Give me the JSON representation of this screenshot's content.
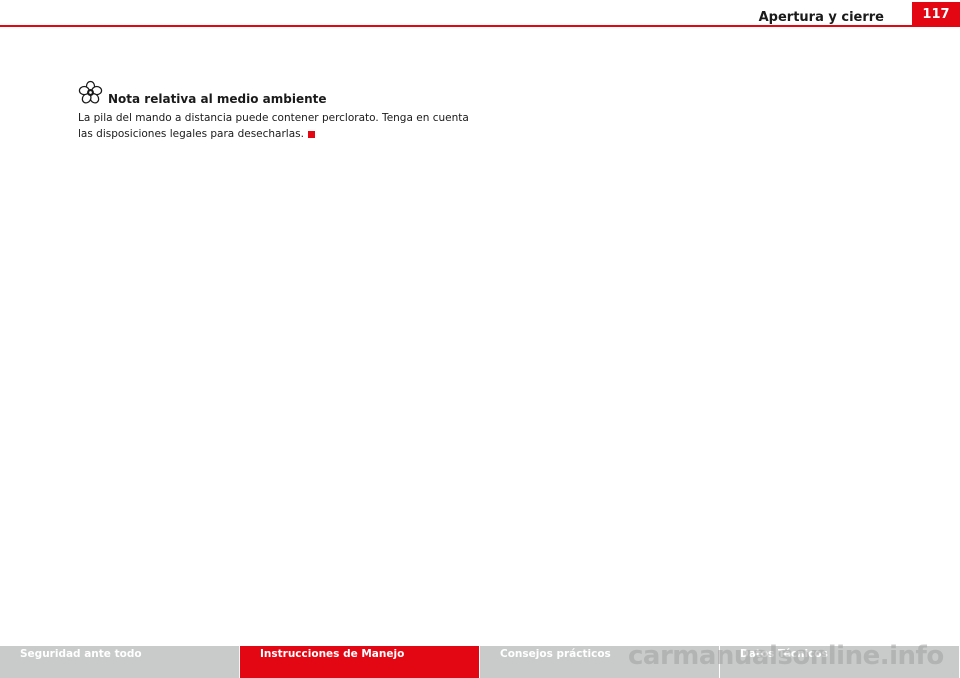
{
  "header": {
    "chapter_title": "Apertura y cierre",
    "page_number": "117",
    "accent_color": "#e30613"
  },
  "note": {
    "icon": "environment-flower-icon",
    "title": "Nota relativa al medio ambiente",
    "body": "La pila del mando a distancia puede contener perclorato. Tenga en cuenta las disposiciones legales para desecharlas."
  },
  "footer": {
    "tabs": [
      {
        "label": "Seguridad ante todo",
        "active": false
      },
      {
        "label": "Instrucciones de Manejo",
        "active": true
      },
      {
        "label": "Consejos prácticos",
        "active": false
      },
      {
        "label": "Datos Técnicos",
        "active": false
      }
    ]
  },
  "watermark": "carmanualsonline.info"
}
